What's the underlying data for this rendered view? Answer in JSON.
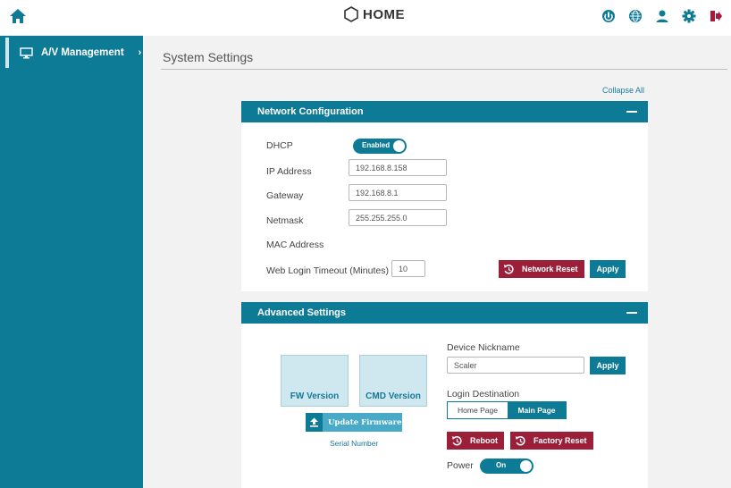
{
  "header": {
    "brand": "HOME"
  },
  "sidebar": {
    "items": [
      {
        "label": "A/V Management",
        "chevron": "›",
        "icon": "monitor-icon"
      }
    ]
  },
  "page": {
    "title": "System Settings",
    "collapse_all": "Collapse All"
  },
  "network": {
    "title": "Network Configuration",
    "dhcp_label": "DHCP",
    "dhcp_toggle": "Enabled",
    "ip_label": "IP Address",
    "ip_value": "192.168.8.158",
    "gateway_label": "Gateway",
    "gateway_value": "192.168.8.1",
    "netmask_label": "Netmask",
    "netmask_value": "255.255.255.0",
    "mac_label": "MAC Address",
    "timeout_label": "Web Login Timeout (Minutes)",
    "timeout_value": "10",
    "reset_button": "Network Reset",
    "apply_button": "Apply"
  },
  "advanced": {
    "title": "Advanced Settings",
    "fw_tile": "FW Version",
    "cmd_tile": "CMD Version",
    "update_button": "Update Firmware",
    "serial_label": "Serial Number",
    "nickname_label": "Device Nickname",
    "nickname_value": "Scaler",
    "apply_button": "Apply",
    "login_dest_label": "Login Destination",
    "login_options": [
      "Home Page",
      "Main Page"
    ],
    "login_selected": "Main Page",
    "reboot_button": "Reboot",
    "factory_reset_button": "Factory Reset",
    "power_label": "Power",
    "power_toggle": "On"
  },
  "colors": {
    "primary": "#0e7b96",
    "danger": "#9c1f3a",
    "logout": "#b0163a",
    "home_icon": "#0e7b96"
  }
}
